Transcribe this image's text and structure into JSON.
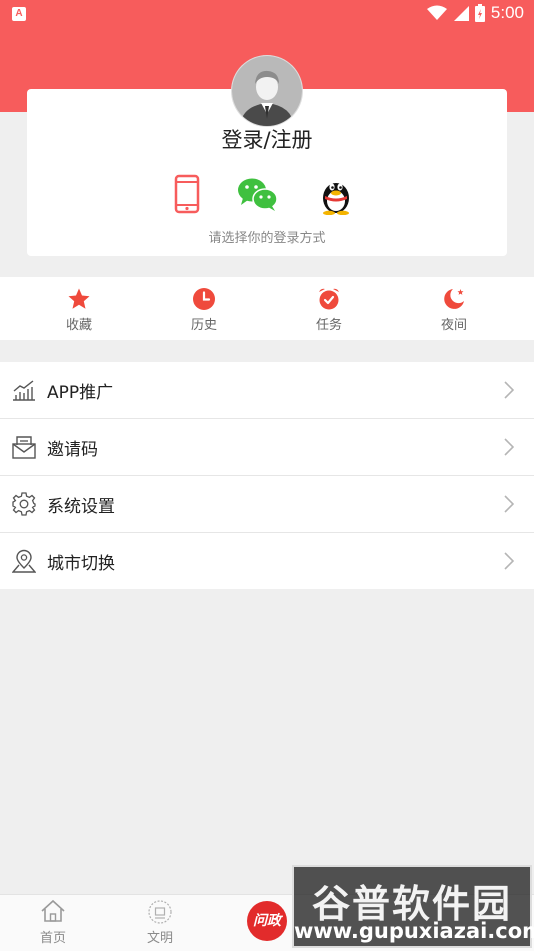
{
  "status_bar": {
    "app_badge": "A",
    "time": "5:00"
  },
  "login": {
    "title": "登录/注册",
    "hint": "请选择你的登录方式",
    "methods": [
      "phone",
      "wechat",
      "qq"
    ]
  },
  "quick": [
    {
      "label": "收藏",
      "icon": "star-icon"
    },
    {
      "label": "历史",
      "icon": "clock-icon"
    },
    {
      "label": "任务",
      "icon": "alarm-icon"
    },
    {
      "label": "夜间",
      "icon": "moon-icon"
    }
  ],
  "menu": [
    {
      "label": "APP推广",
      "icon": "chart-icon"
    },
    {
      "label": "邀请码",
      "icon": "mail-icon"
    },
    {
      "label": "系统设置",
      "icon": "gear-icon"
    },
    {
      "label": "城市切换",
      "icon": "location-icon"
    }
  ],
  "nav": [
    {
      "label": "首页",
      "icon": "home-icon"
    },
    {
      "label": "文明",
      "icon": "emblem-icon"
    }
  ],
  "nav_center": {
    "label": "问政"
  },
  "watermark": {
    "title": "谷普软件园",
    "url": "www.gupuxiazai.com"
  },
  "colors": {
    "accent": "#f75c5c",
    "wechat": "#3fc03f",
    "star": "#ef4a3c"
  }
}
